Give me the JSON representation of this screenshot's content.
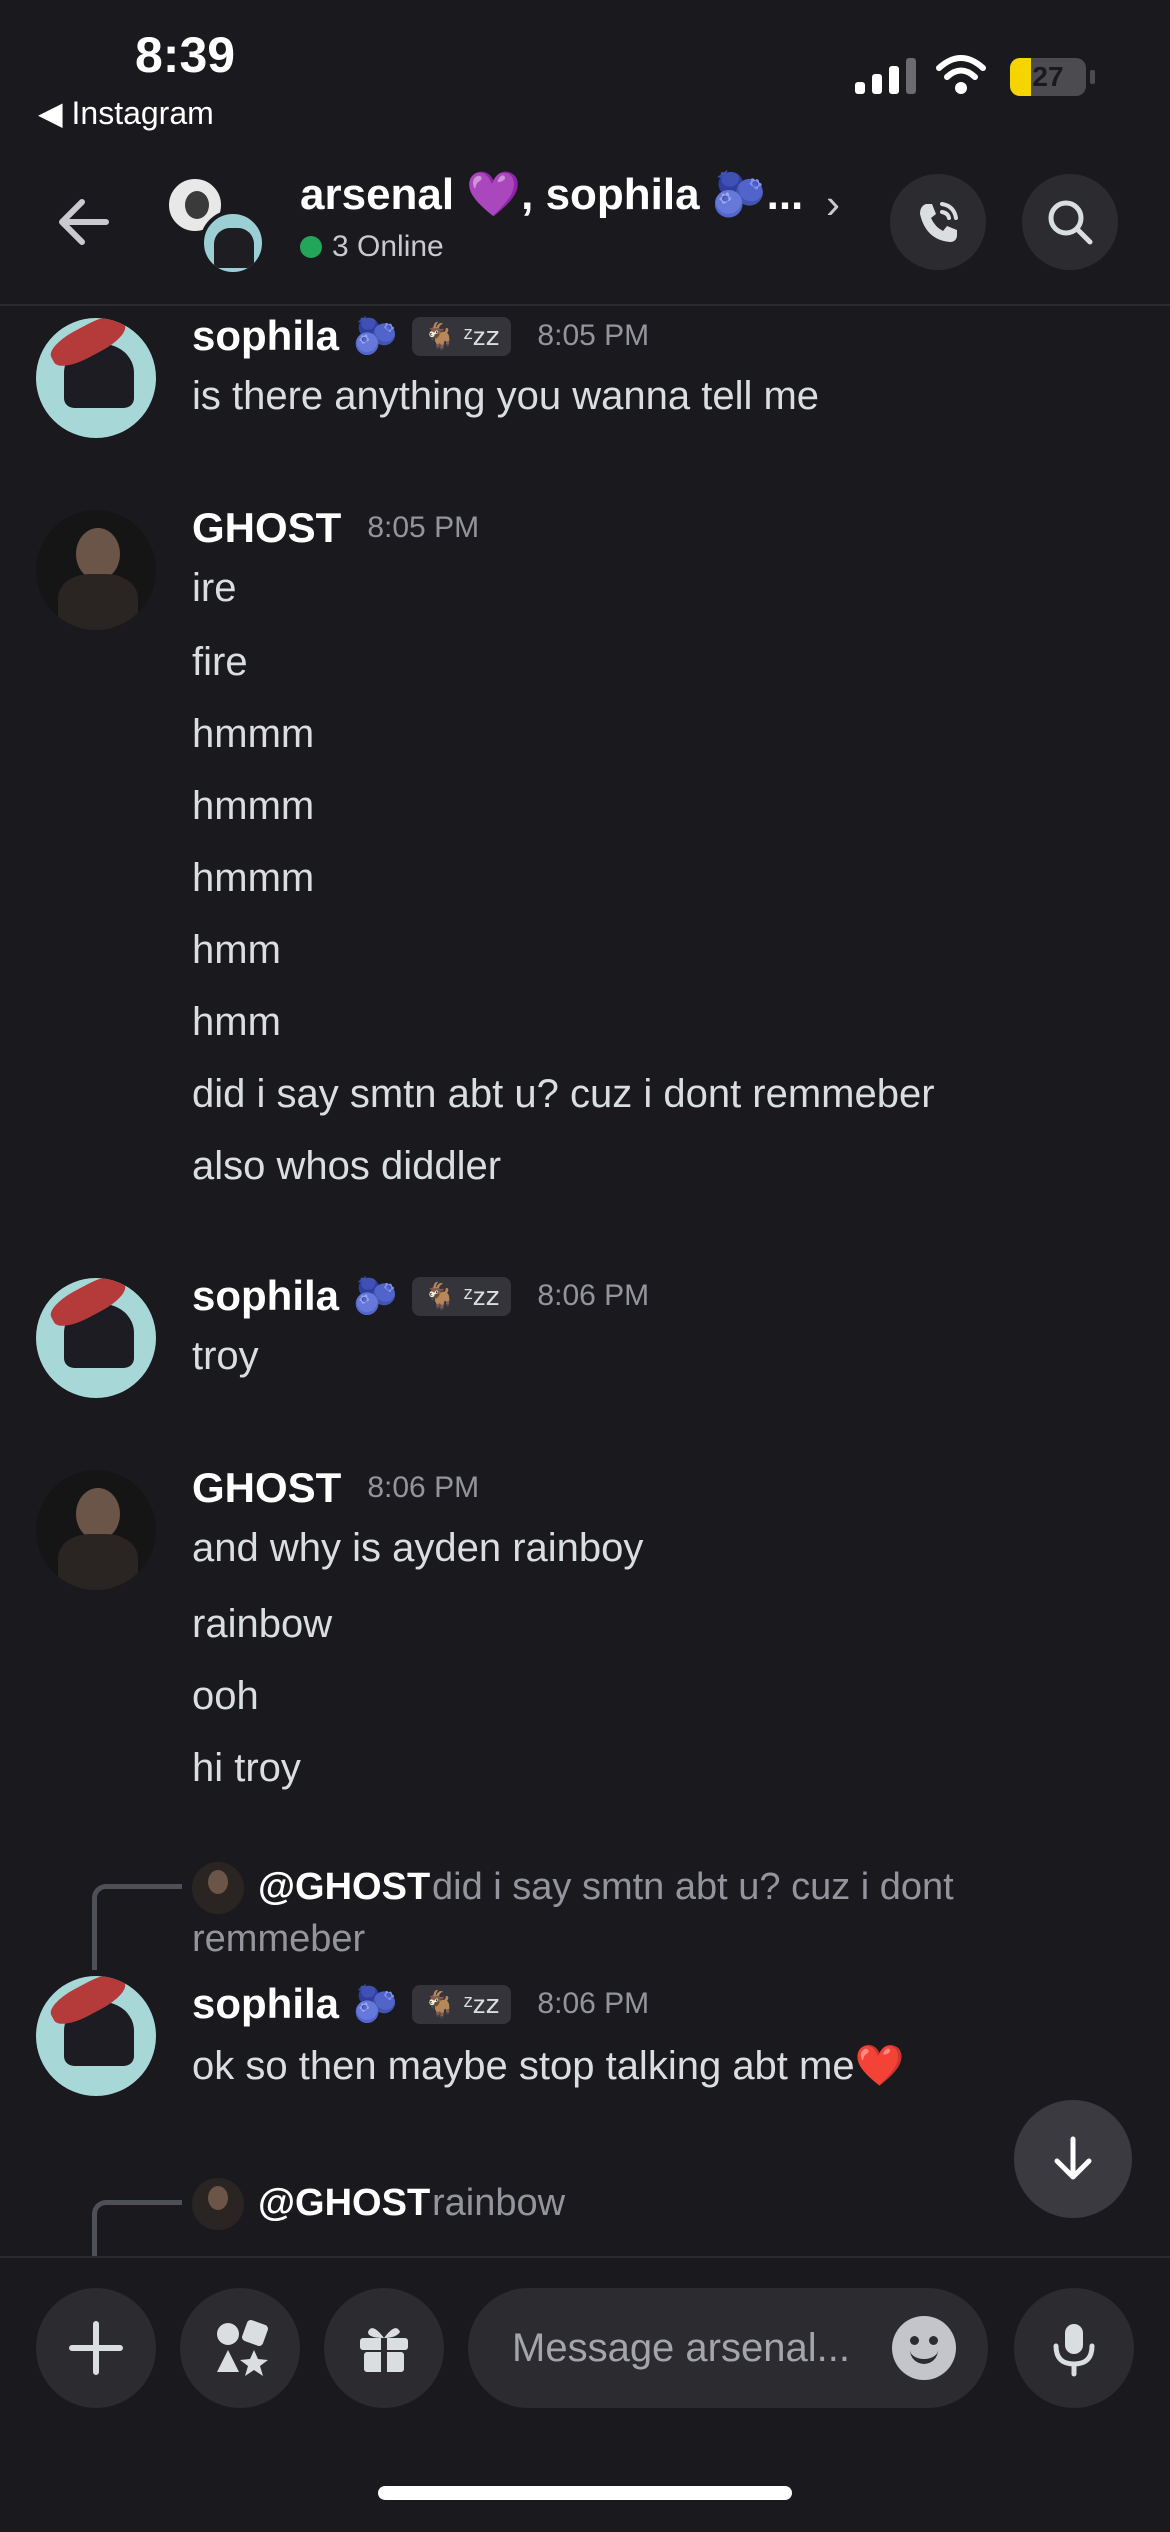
{
  "status_bar": {
    "time": "8:39",
    "back_app": "◀ Instagram",
    "battery_pct": "27",
    "battery_level": 0.27,
    "battery_color": "#f5d400"
  },
  "header": {
    "title": "arsenal 💜, sophila 🫐...",
    "online": "3 Online",
    "online_color": "#23a55a"
  },
  "messages": [
    {
      "author": "sophila",
      "emoji": "🫐",
      "tag": "🐐 ᶻz𝗓",
      "time": "8:05 PM",
      "lines": [
        "is there anything you wanna tell me"
      ]
    },
    {
      "author": "GHOST",
      "time": "8:05 PM",
      "lines": [
        "ire",
        "fire",
        "hmmm",
        "hmmm",
        "hmmm",
        "hmm",
        "hmm",
        "did i say smtn abt u? cuz i dont remmeber",
        "also whos diddler"
      ]
    },
    {
      "author": "sophila",
      "emoji": "🫐",
      "tag": "🐐 ᶻz𝗓",
      "time": "8:06 PM",
      "lines": [
        "troy"
      ]
    },
    {
      "author": "GHOST",
      "time": "8:06 PM",
      "lines": [
        "and why is ayden rainboy",
        "rainbow",
        "ooh",
        "hi troy"
      ]
    },
    {
      "author": "sophila",
      "emoji": "🫐",
      "tag": "🐐 ᶻz𝗓",
      "time": "8:06 PM",
      "reply": {
        "name": "@GHOST",
        "text_1": "did i say smtn abt u? cuz i dont",
        "text_2": "remmeber"
      },
      "lines": [
        "ok so then maybe stop talking abt me❤️"
      ]
    },
    {
      "reply": {
        "name": "@GHOST",
        "text_1": "rainbow"
      }
    }
  ],
  "composer": {
    "placeholder": "Message arsenal..."
  },
  "icons": [
    "back-arrow-icon",
    "phone-icon",
    "search-icon",
    "chevron-right-icon",
    "arrow-down-icon",
    "plus-icon",
    "apps-icon",
    "gift-icon",
    "emoji-icon",
    "microphone-icon"
  ]
}
